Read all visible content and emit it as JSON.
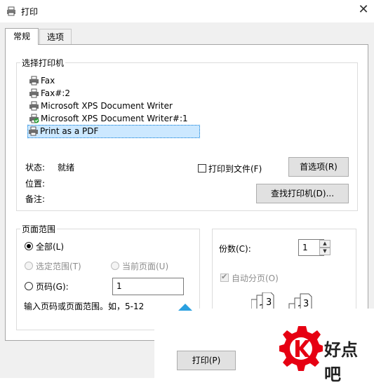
{
  "window": {
    "title": "打印",
    "close_glyph": "✕"
  },
  "tabs": [
    {
      "label": "常规"
    },
    {
      "label": "选项"
    }
  ],
  "printer_group": {
    "label": "选择打印机",
    "printers": [
      {
        "name": "Fax",
        "icon": "printer-icon"
      },
      {
        "name": "Fax#:2",
        "icon": "printer-icon"
      },
      {
        "name": "Microsoft XPS Document Writer",
        "icon": "printer-icon"
      },
      {
        "name": "Microsoft XPS Document Writer#:1",
        "icon": "printer-default-icon"
      },
      {
        "name": "Print as a PDF",
        "icon": "printer-icon",
        "selected": true
      }
    ],
    "status_label": "状态:",
    "status_value": "就绪",
    "location_label": "位置:",
    "comment_label": "备注:",
    "print_to_file_label": "打印到文件(F)",
    "preferences_button": "首选项(R)",
    "find_printer_button": "查找打印机(D)..."
  },
  "page_range": {
    "label": "页面范围",
    "all_label": "全部(L)",
    "selection_label": "选定范围(T)",
    "current_page_label": "当前页面(U)",
    "pages_label": "页码(G):",
    "pages_value": "1",
    "hint": "输入页码或页面范围。如，5-12"
  },
  "copies": {
    "label": "份数(C):",
    "value": "1",
    "collate_label": "自动分页(O)"
  },
  "footer": {
    "print_button": "打印(P)"
  },
  "watermark": {
    "text": "好点吧",
    "accent_color": "#e60012"
  }
}
